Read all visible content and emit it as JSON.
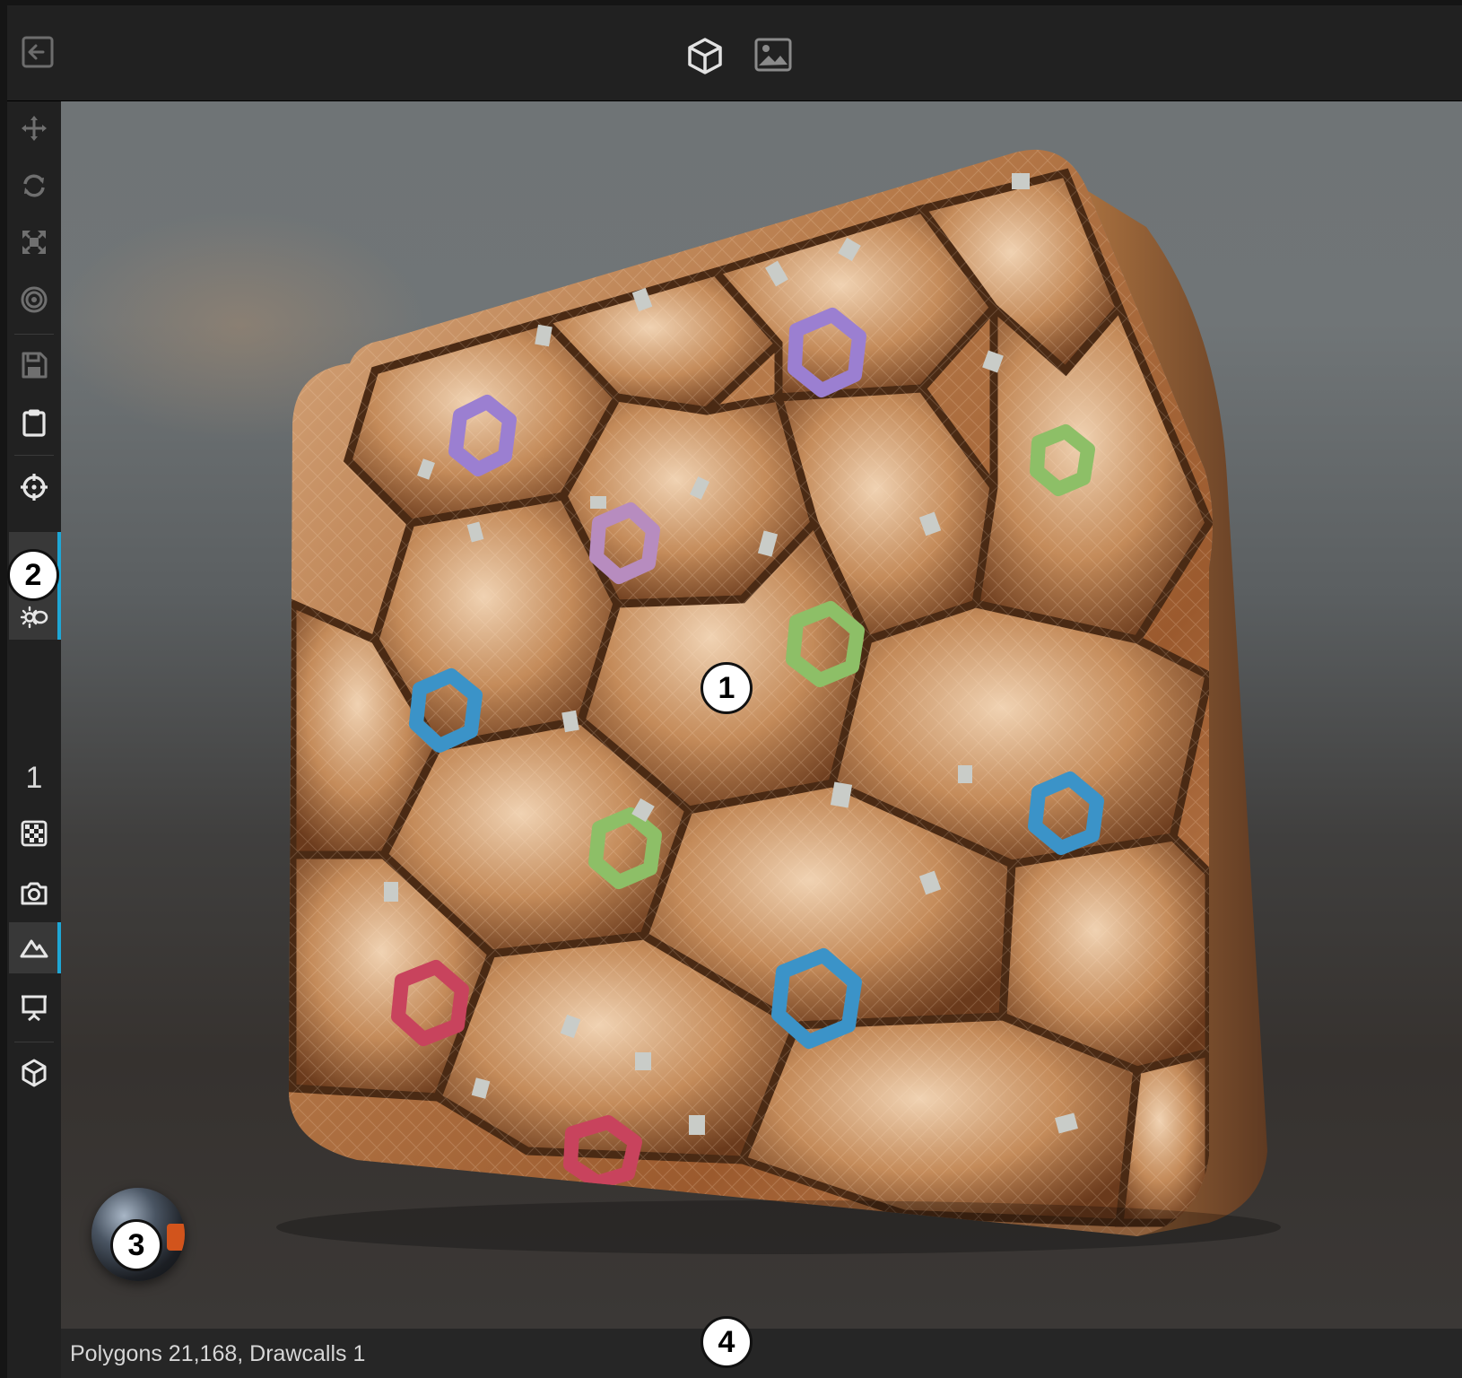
{
  "topbar": {
    "back_icon": "exit-arrow-icon",
    "view_3d_icon": "cube-icon",
    "view_2d_icon": "image-icon"
  },
  "sidebar": {
    "tools": [
      {
        "name": "move-icon"
      },
      {
        "name": "rotate-icon"
      },
      {
        "name": "scale-icon"
      },
      {
        "name": "target-rings-icon"
      },
      {
        "name": "save-icon"
      },
      {
        "name": "clipboard-icon"
      },
      {
        "name": "crosshair-icon"
      },
      {
        "name": "lighting-icon",
        "active": true
      },
      {
        "name": "checker-icon"
      },
      {
        "name": "camera-icon"
      },
      {
        "name": "terrain-icon",
        "active": true
      },
      {
        "name": "presentation-icon"
      },
      {
        "name": "cube-icon"
      }
    ],
    "lod_value": "1"
  },
  "viewport": {
    "object": "quilted hexagon material cube",
    "accent_colors": {
      "copper": "#b67a4a",
      "purple": "#9b7fd1",
      "blue": "#3b93c8",
      "green": "#8dbf67",
      "red": "#c8435d"
    }
  },
  "status": {
    "text": "Polygons 21,168, Drawcalls 1"
  },
  "callouts": [
    "1",
    "2",
    "3",
    "4"
  ]
}
